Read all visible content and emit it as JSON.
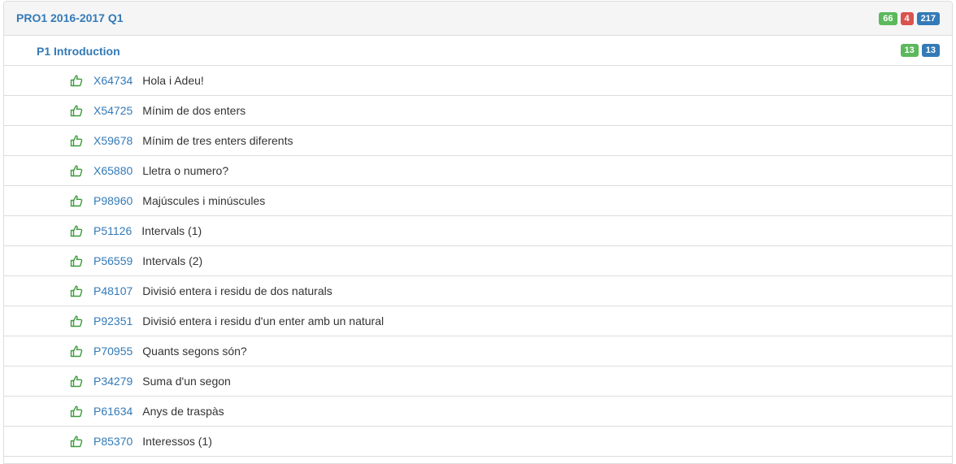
{
  "course": {
    "title": "PRO1 2016-2017 Q1",
    "badges": {
      "accepted": "66",
      "rejected": "4",
      "total": "217"
    }
  },
  "list": {
    "title": "P1 Introduction",
    "badges": {
      "accepted": "13",
      "total": "13"
    }
  },
  "colors": {
    "link": "#337ab7",
    "success": "#5cb85c",
    "danger": "#d9534f",
    "primary": "#337ab7",
    "thumb": "#3c9a3c"
  },
  "problems": [
    {
      "code": "X64734",
      "title": "Hola i Adeu!",
      "status_icon": "thumbs-up-icon"
    },
    {
      "code": "X54725",
      "title": "Mínim de dos enters",
      "status_icon": "thumbs-up-icon"
    },
    {
      "code": "X59678",
      "title": "Mínim de tres enters diferents",
      "status_icon": "thumbs-up-icon"
    },
    {
      "code": "X65880",
      "title": "Lletra o numero?",
      "status_icon": "thumbs-up-icon"
    },
    {
      "code": "P98960",
      "title": "Majúscules i minúscules",
      "status_icon": "thumbs-up-icon"
    },
    {
      "code": "P51126",
      "title": "Intervals (1)",
      "status_icon": "thumbs-up-icon"
    },
    {
      "code": "P56559",
      "title": "Intervals (2)",
      "status_icon": "thumbs-up-icon"
    },
    {
      "code": "P48107",
      "title": "Divisió entera i residu de dos naturals",
      "status_icon": "thumbs-up-icon"
    },
    {
      "code": "P92351",
      "title": "Divisió entera i residu d'un enter amb un natural",
      "status_icon": "thumbs-up-icon"
    },
    {
      "code": "P70955",
      "title": "Quants segons són?",
      "status_icon": "thumbs-up-icon"
    },
    {
      "code": "P34279",
      "title": "Suma d'un segon",
      "status_icon": "thumbs-up-icon"
    },
    {
      "code": "P61634",
      "title": "Anys de traspàs",
      "status_icon": "thumbs-up-icon"
    },
    {
      "code": "P85370",
      "title": "Interessos (1)",
      "status_icon": "thumbs-up-icon"
    }
  ]
}
